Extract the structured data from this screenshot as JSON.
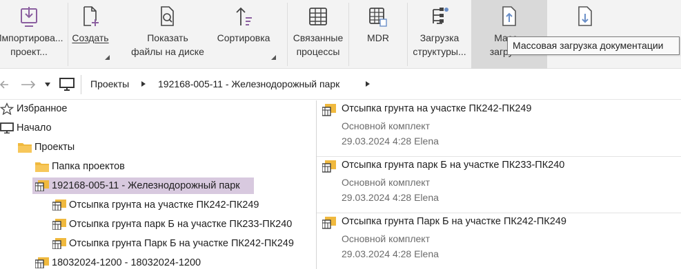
{
  "ribbon": {
    "import": {
      "line1": "Импортирова...",
      "line2": "проект...",
      "icon": "import-icon"
    },
    "create": {
      "line1": "Создать",
      "icon": "new-document-icon"
    },
    "show_files": {
      "line1": "Показать",
      "line2": "файлы на диске",
      "icon": "show-files-icon"
    },
    "sort": {
      "line1": "Сортировка",
      "icon": "sort-icon"
    },
    "related": {
      "line1": "Связанные",
      "line2": "процессы",
      "icon": "table-icon"
    },
    "mdr": {
      "line1": "MDR",
      "icon": "mdr-table-icon"
    },
    "load_structure": {
      "line1": "Загрузка",
      "line2": "структуры...",
      "icon": "structure-tree-icon"
    },
    "bulk_upload": {
      "line1": "Масс",
      "line2": "загрузк",
      "icon": "upload-document-icon"
    },
    "bulk_download": {
      "line1": "",
      "line2": "",
      "icon": "download-document-icon"
    },
    "tooltip": "Массовая загрузка документации",
    "accent": "#8b5fa0"
  },
  "nav": {
    "crumbs": [
      "Проекты",
      "192168-005-11 - Железнодорожный парк"
    ]
  },
  "tree": [
    {
      "label": "Избранное",
      "icon": "star-icon"
    },
    {
      "label": "Начало",
      "icon": "monitor-icon"
    },
    {
      "label": "Проекты",
      "icon": "folder-icon"
    },
    {
      "label": "Папка проектов",
      "icon": "folder-icon"
    },
    {
      "label": "192168-005-11 - Железнодорожный парк",
      "icon": "project-icon"
    },
    {
      "label": "Отсыпка грунта на участке ПК242-ПК249",
      "icon": "project-folder-icon"
    },
    {
      "label": "Отсыпка грунта парк Б на участке ПК233-ПК240",
      "icon": "project-folder-icon"
    },
    {
      "label": "Отсыпка грунта Парк Б на участке ПК242-ПК249",
      "icon": "project-folder-icon"
    },
    {
      "label": "18032024-1200 - 18032024-1200",
      "icon": "project-icon"
    }
  ],
  "list": [
    {
      "title": "Отсыпка грунта на участке ПК242-ПК249",
      "subtitle": "Основной комплект",
      "meta": "29.03.2024 4:28 Elena"
    },
    {
      "title": "Отсыпка грунта парк Б на участке ПК233-ПК240",
      "subtitle": "Основной комплект",
      "meta": "29.03.2024 4:28 Elena"
    },
    {
      "title": "Отсыпка грунта Парк Б на участке ПК242-ПК249",
      "subtitle": "Основной комплект",
      "meta": "29.03.2024 4:28 Elena"
    }
  ]
}
